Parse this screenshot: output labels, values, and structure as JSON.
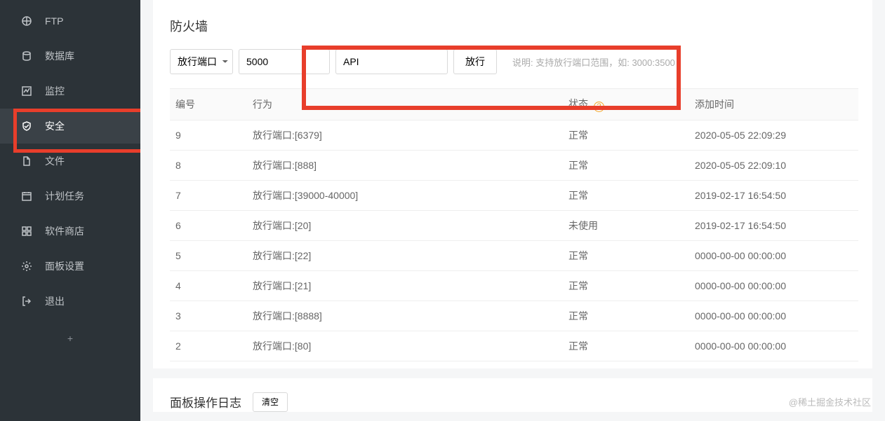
{
  "sidebar": {
    "items": [
      {
        "label": "FTP",
        "icon": "ftp-icon"
      },
      {
        "label": "数据库",
        "icon": "database-icon"
      },
      {
        "label": "监控",
        "icon": "monitor-icon"
      },
      {
        "label": "安全",
        "icon": "shield-icon"
      },
      {
        "label": "文件",
        "icon": "file-icon"
      },
      {
        "label": "计划任务",
        "icon": "calendar-icon"
      },
      {
        "label": "软件商店",
        "icon": "grid-icon"
      },
      {
        "label": "面板设置",
        "icon": "gear-icon"
      },
      {
        "label": "退出",
        "icon": "exit-icon"
      }
    ],
    "add": "+"
  },
  "firewall": {
    "title": "防火墙",
    "select_label": "放行端口",
    "port_value": "5000",
    "name_value": "API",
    "submit_label": "放行",
    "hint": "说明: 支持放行端口范围，如: 3000:3500",
    "headers": {
      "id": "编号",
      "action": "行为",
      "status": "状态",
      "time": "添加时间"
    },
    "rows": [
      {
        "id": "9",
        "action": "放行端口:[6379]",
        "status": "正常",
        "time": "2020-05-05 22:09:29"
      },
      {
        "id": "8",
        "action": "放行端口:[888]",
        "status": "正常",
        "time": "2020-05-05 22:09:10"
      },
      {
        "id": "7",
        "action": "放行端口:[39000-40000]",
        "status": "正常",
        "time": "2019-02-17 16:54:50"
      },
      {
        "id": "6",
        "action": "放行端口:[20]",
        "status": "未使用",
        "time": "2019-02-17 16:54:50"
      },
      {
        "id": "5",
        "action": "放行端口:[22]",
        "status": "正常",
        "time": "0000-00-00 00:00:00"
      },
      {
        "id": "4",
        "action": "放行端口:[21]",
        "status": "正常",
        "time": "0000-00-00 00:00:00"
      },
      {
        "id": "3",
        "action": "放行端口:[8888]",
        "status": "正常",
        "time": "0000-00-00 00:00:00"
      },
      {
        "id": "2",
        "action": "放行端口:[80]",
        "status": "正常",
        "time": "0000-00-00 00:00:00"
      }
    ]
  },
  "log": {
    "title": "面板操作日志",
    "clear_label": "清空"
  },
  "watermark": "@稀土掘金技术社区"
}
